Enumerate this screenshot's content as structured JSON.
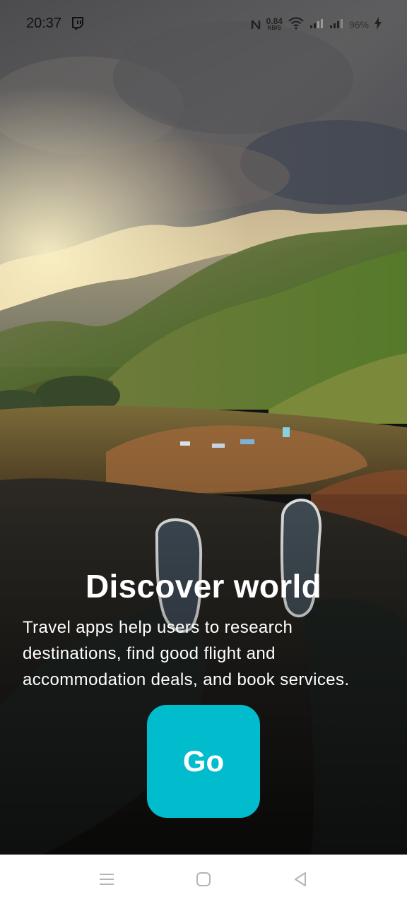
{
  "status_bar": {
    "time": "20:37",
    "left_icon": "twitch-icon",
    "nfc_icon": "nfc-icon",
    "speed_value": "0.84",
    "speed_unit": "KB/S",
    "wifi_icon": "wifi-icon",
    "signal_icons": [
      "signal-icon",
      "signal-icon"
    ],
    "battery": "96%",
    "charging_icon": "charging-bolt-icon"
  },
  "hero": {
    "title": "Discover world",
    "description": "Travel apps help users to research destinations, find good flight and accommodation deals, and book services.",
    "go_label": "Go"
  },
  "colors": {
    "accent": "#00bccc",
    "title_text": "#ffffff",
    "nav_background": "#ffffff"
  },
  "nav_bar": {
    "items": [
      "menu-icon",
      "home-square-icon",
      "back-triangle-icon"
    ]
  }
}
